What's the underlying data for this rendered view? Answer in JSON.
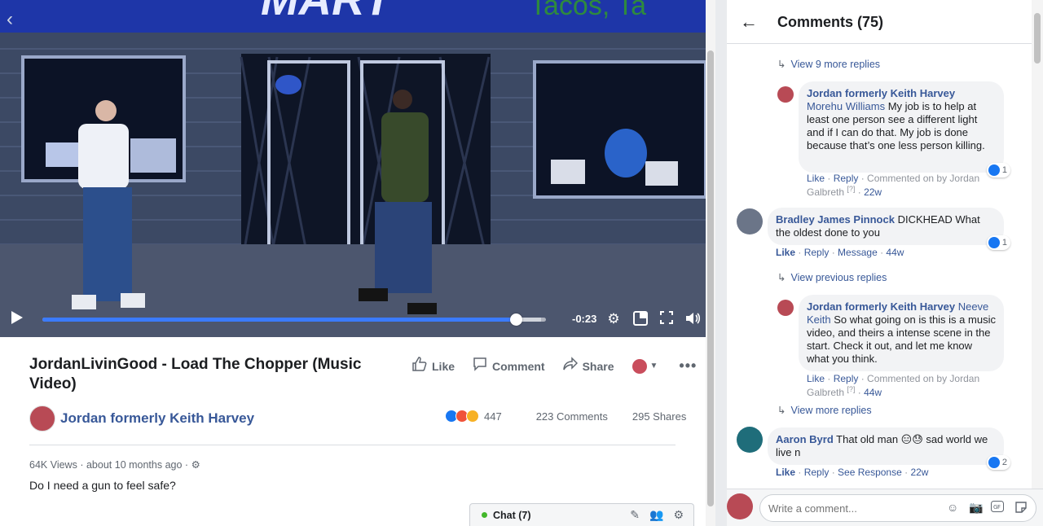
{
  "video": {
    "time_remaining": "-0:23",
    "progress": 0.94,
    "buffered": 0.99,
    "sign_text": "MART",
    "sign_text_right": "Tacos, Ta"
  },
  "post": {
    "title": "JordanLivinGood - Load The Chopper (Music Video)",
    "actions": {
      "like": "Like",
      "comment": "Comment",
      "share": "Share"
    },
    "owner": "Jordan formerly Keith Harvey",
    "reaction_count": "447",
    "comments": "223 Comments",
    "shares": "295 Shares",
    "views": "64K Views",
    "time": "about 10 months ago",
    "sep": "·",
    "description": "Do I need a gun to feel safe?"
  },
  "chat": {
    "label": "Chat (7)"
  },
  "comments_panel": {
    "title": "Comments (75)",
    "view_9_more": "View 9 more replies",
    "reply1": {
      "author": "Jordan formerly Keith Harvey",
      "tag": "Morehu Williams",
      "text": " My job is to help at least one person see a different light and if I can do that. My job is done because that’s one less person killing.",
      "like": "Like",
      "reply": "Reply",
      "commented_on_by": "Commented on by Jordan Galbreth",
      "q": "[?]",
      "time": "22w",
      "reactions": "1"
    },
    "comment2": {
      "author": "Bradley James Pinnock",
      "text": " DICKHEAD What the oldest done to you",
      "like": "Like",
      "reply": "Reply",
      "message": "Message",
      "time": "44w",
      "reactions": "1"
    },
    "view_previous": "View previous replies",
    "reply2": {
      "author": "Jordan formerly Keith Harvey",
      "tag": "Neeve Keith",
      "text": " So what going on is this is a music video, and theirs a intense scene in the start. Check it out, and let me know what you think.",
      "like": "Like",
      "reply": "Reply",
      "commented_on_by": "Commented on by Jordan Galbreth",
      "q": "[?]",
      "time": "44w"
    },
    "view_more": "View more replies",
    "comment3": {
      "author": "Aaron Byrd",
      "text_before": " That old man ",
      "text_after": " sad world we live n",
      "like": "Like",
      "reply": "Reply",
      "see_response": "See Response",
      "time": "22w",
      "reactions": "2"
    },
    "composer_placeholder": "Write a comment..."
  }
}
